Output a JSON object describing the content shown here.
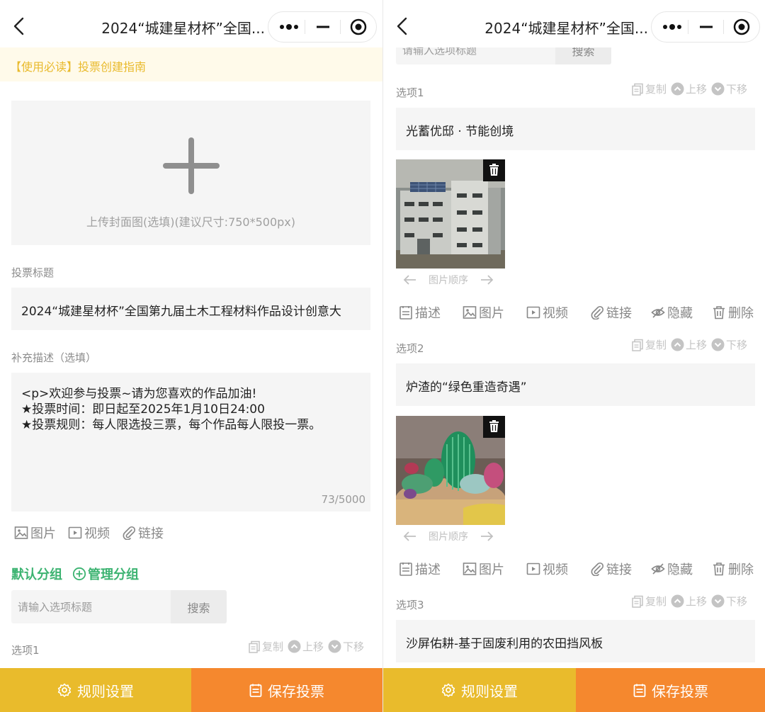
{
  "nav": {
    "title": "2024“城建星材杯”全国..."
  },
  "notice": {
    "text": "【使用必读】投票创建指南"
  },
  "cover": {
    "hint": "上传封面图(选填)(建议尺寸:750*500px)"
  },
  "vote_title": {
    "label": "投票标题",
    "value": "2024“城建星材杯”全国第九届土木工程材料作品设计创意大"
  },
  "description": {
    "label": "补充描述（选填）",
    "lines": [
      "<p>欢迎参与投票~请为您喜欢的作品加油!",
      "★投票时间：即日起至2025年1月10日24:00",
      "★投票规则：每人限选投三票，每个作品每人限投一票。"
    ],
    "count": "73/5000"
  },
  "desc_tools": {
    "image": "图片",
    "video": "视频",
    "link": "链接"
  },
  "groups": {
    "default": "默认分组",
    "manage": "管理分组"
  },
  "search": {
    "placeholder": "请输入选项标题",
    "button": "搜索"
  },
  "option_actions": {
    "copy": "复制",
    "up": "上移",
    "down": "下移"
  },
  "option_tools": {
    "describe": "描述",
    "image": "图片",
    "video": "视频",
    "link": "链接",
    "hide": "隐藏",
    "delete": "删除"
  },
  "image_order": "图片顺序",
  "options": [
    {
      "label": "选项1",
      "title": "光蓄优邸 · 节能创境"
    },
    {
      "label": "选项2",
      "title": "炉渣的“绿色重造奇遇”"
    },
    {
      "label": "选项3",
      "title": "沙屏佑耕-基于固废利用的农田挡风板"
    }
  ],
  "bottom": {
    "rules": "规则设置",
    "save": "保存投票"
  },
  "colors": {
    "accent_green": "#3cb371",
    "rules_yellow": "#e9bb2c",
    "save_orange": "#f5882e",
    "notice_text": "#e9ba2c"
  }
}
